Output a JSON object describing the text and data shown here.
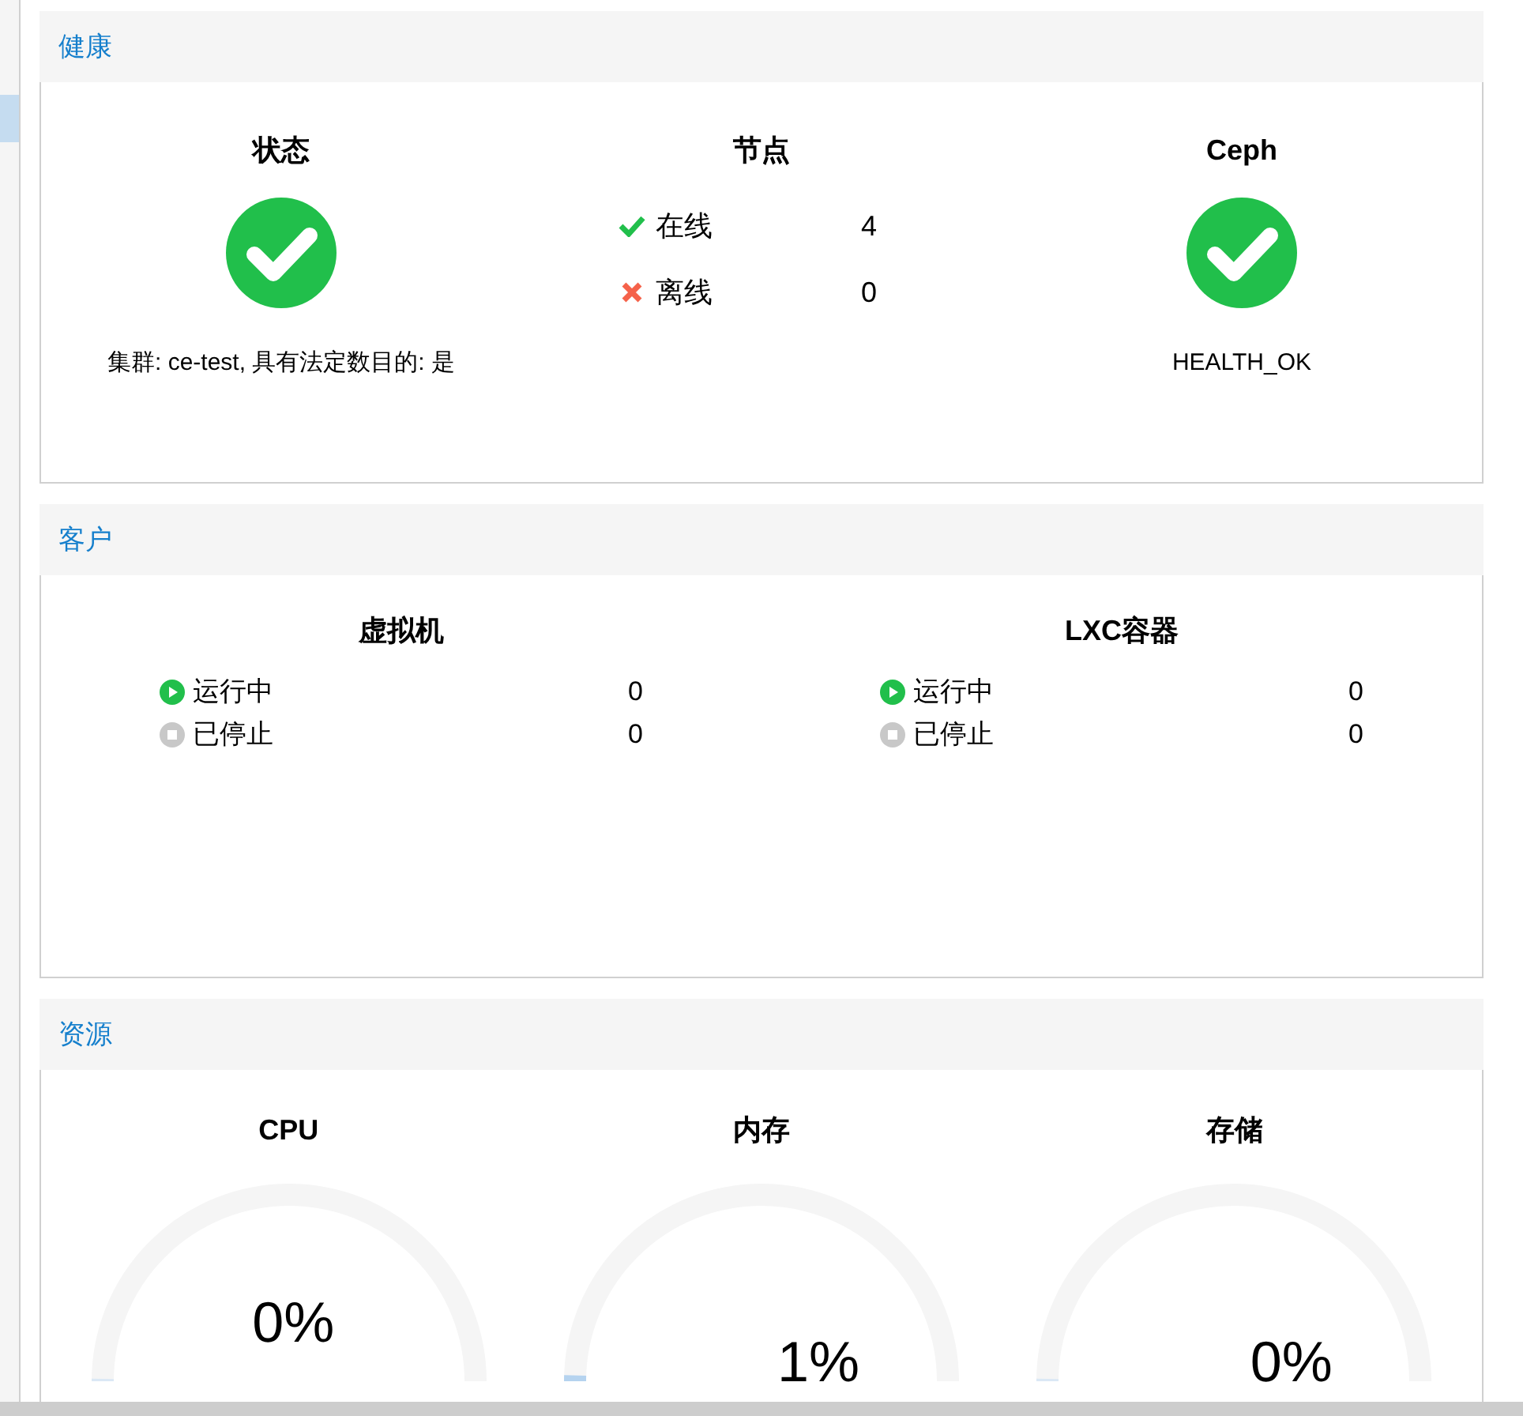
{
  "health": {
    "title": "健康",
    "status": {
      "title": "状态",
      "ok": true,
      "text": "集群: ce-test, 具有法定数目的: 是"
    },
    "nodes": {
      "title": "节点",
      "rows": [
        {
          "kind": "online",
          "label": "在线",
          "count": "4"
        },
        {
          "kind": "offline",
          "label": "离线",
          "count": "0"
        }
      ]
    },
    "ceph": {
      "title": "Ceph",
      "ok": true,
      "text": "HEALTH_OK"
    }
  },
  "guests": {
    "title": "客户",
    "groups": [
      {
        "title": "虚拟机",
        "rows": [
          {
            "kind": "running",
            "label": "运行中",
            "count": "0"
          },
          {
            "kind": "stopped",
            "label": "已停止",
            "count": "0"
          }
        ]
      },
      {
        "title": "LXC容器",
        "rows": [
          {
            "kind": "running",
            "label": "运行中",
            "count": "0"
          },
          {
            "kind": "stopped",
            "label": "已停止",
            "count": "0"
          }
        ]
      }
    ]
  },
  "resources": {
    "title": "资源",
    "gauges": [
      {
        "title": "CPU",
        "level": 0,
        "reading": "0%"
      },
      {
        "title": "内存",
        "level": 0.01,
        "reading": "1%"
      },
      {
        "title": "存储",
        "level": 0,
        "reading": "0%"
      }
    ]
  }
}
